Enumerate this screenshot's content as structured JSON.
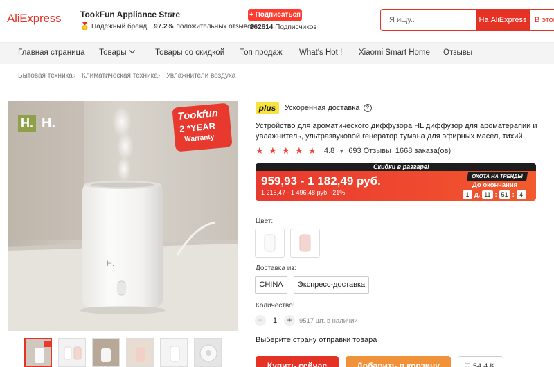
{
  "header": {
    "logo": "AliExpress",
    "store_name": "TookFun Appliance Store",
    "trusted_label": "Надёжный бренд",
    "positive_pct": "97.2%",
    "positive_label": "положительных отзывов",
    "subscribe_label": "+ Подписаться",
    "subscribers_count": "262614",
    "subscribers_label": "Подписчиков",
    "search_placeholder": "Я ищу..",
    "search_aliexpress_label": "На AliExpress",
    "search_store_label": "В этом"
  },
  "nav": {
    "items": [
      "Главная страница",
      "Товары",
      "Товары со скидкой",
      "Топ продаж",
      "What's Hot !",
      "Xiaomi Smart Home",
      "Отзывы"
    ]
  },
  "breadcrumb": [
    "Бытовая техника",
    "Климатическая техника",
    "Увлажнители воздуха"
  ],
  "gallery": {
    "brand_mark": "H. H.",
    "promo_brand": "Tookfun",
    "promo_year": "2 *YEAR",
    "promo_warranty": "Warranty",
    "device_logo": "H."
  },
  "product": {
    "plus_badge": "plus",
    "delivery_label": "Ускоренная доставка",
    "help": "?",
    "title": "Устройство для ароматического диффузора HL диффузор для ароматерапии и увлажнитель, ультразвуковой генератор тумана для эфирных масел, тихий",
    "rating": "4.8",
    "reviews": "693 Отзывы",
    "orders": "1668 заказа(ов)",
    "sale_banner": "Скидки в разгаре!",
    "price": "959,93 - 1 182,49 руб.",
    "old_price": "1 215,47 - 1 496,48 руб.",
    "discount": "-21%",
    "hunt_badge": "ОХОТА НА ТРЕНДЫ",
    "until_label": "До окончания",
    "timer": {
      "days": "1",
      "days_label": "д.",
      "hours": "11",
      "minutes": "51",
      "seconds": "4"
    },
    "color_label": "Цвет:",
    "shipping_label": "Доставка из:",
    "ship_options": [
      "CHINA",
      "Экспресс-доставка"
    ],
    "quantity_label": "Количество:",
    "qty_minus": "−",
    "qty_plus": "+",
    "quantity": "1",
    "stock": "9517 шт. в наличии",
    "ship_note": "Выберите страну отправки товара",
    "buy_label": "Купить сейчас",
    "cart_label": "Добавить в корзину",
    "wish_label": "♡ 54,4 K"
  },
  "colors": {
    "accent": "#e43225",
    "orange": "#f0923a",
    "plus_yellow": "#f8e23c"
  }
}
